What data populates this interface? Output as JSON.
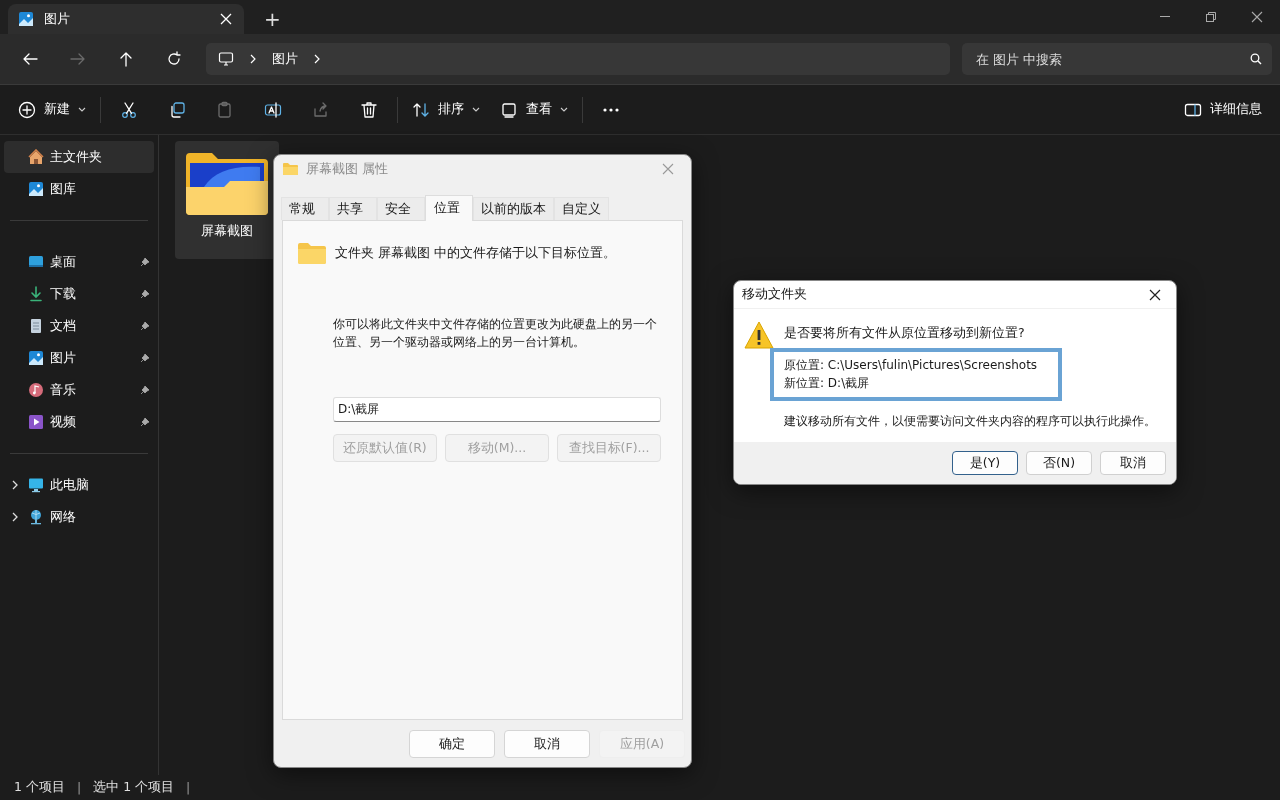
{
  "tabs": [
    {
      "title": "图片",
      "selected": true
    }
  ],
  "new_tab": "+",
  "nav": [
    {
      "kind": "back",
      "disabled": false
    },
    {
      "kind": "forward",
      "disabled": true
    },
    {
      "kind": "up",
      "disabled": false
    },
    {
      "kind": "refresh",
      "disabled": false
    }
  ],
  "breadcrumb": [
    "图片"
  ],
  "search": {
    "placeholder": "在 图片 中搜索"
  },
  "commands": [
    {
      "kind": "new",
      "label": "新建",
      "dropdown": true,
      "disabled": false
    },
    {
      "kind": "cut",
      "disabled": false
    },
    {
      "kind": "copy",
      "disabled": false
    },
    {
      "kind": "paste",
      "disabled": true
    },
    {
      "kind": "rename",
      "disabled": false
    },
    {
      "kind": "share",
      "disabled": true
    },
    {
      "kind": "delete",
      "disabled": false
    },
    {
      "kind": "sort",
      "label": "排序",
      "dropdown": true,
      "disabled": false
    },
    {
      "kind": "view",
      "label": "查看",
      "dropdown": true,
      "disabled": false
    },
    {
      "kind": "more",
      "disabled": false
    }
  ],
  "details_button": "详细信息",
  "sidebar": {
    "groups": [
      [
        {
          "kind": "home",
          "label": "主文件夹",
          "selected": true,
          "pinned": false
        },
        {
          "kind": "gallery",
          "label": "图库",
          "selected": false,
          "pinned": false
        }
      ],
      [
        {
          "kind": "desktop",
          "label": "桌面",
          "selected": false,
          "pinned": true
        },
        {
          "kind": "download",
          "label": "下载",
          "selected": false,
          "pinned": true
        },
        {
          "kind": "document",
          "label": "文档",
          "selected": false,
          "pinned": true
        },
        {
          "kind": "gallery",
          "label": "图片",
          "selected": false,
          "pinned": true
        },
        {
          "kind": "music",
          "label": "音乐",
          "selected": false,
          "pinned": true
        },
        {
          "kind": "video",
          "label": "视频",
          "selected": false,
          "pinned": true
        }
      ],
      [
        {
          "kind": "pc",
          "label": "此电脑",
          "selected": false,
          "pinned": false,
          "expanded": false
        },
        {
          "kind": "network",
          "label": "网络",
          "selected": false,
          "pinned": false,
          "expanded": false
        }
      ]
    ]
  },
  "files": [
    {
      "name": "屏幕截图",
      "selected": true
    }
  ],
  "status_bar": [
    {
      "kind": "text",
      "text": "1 个项目"
    },
    {
      "kind": "separator",
      "text": "|"
    },
    {
      "kind": "text",
      "text": "选中 1 个项目"
    },
    {
      "kind": "separator",
      "text": "|"
    }
  ],
  "properties_dialog": {
    "title": "屏幕截图 属性",
    "tabs": [
      {
        "label": "常规",
        "selected": false
      },
      {
        "label": "共享",
        "selected": false
      },
      {
        "label": "安全",
        "selected": false
      },
      {
        "label": "位置",
        "selected": true
      },
      {
        "label": "以前的版本",
        "selected": false
      },
      {
        "label": "自定义",
        "selected": false
      }
    ],
    "heading": "文件夹 屏幕截图 中的文件存储于以下目标位置。",
    "description": "你可以将此文件夹中文件存储的位置更改为此硬盘上的另一个位置、另一个驱动器或网络上的另一台计算机。",
    "path_value": "D:\\截屏",
    "actions": [
      {
        "label": "还原默认值(R)",
        "disabled": true
      },
      {
        "label": "移动(M)...",
        "disabled": true
      },
      {
        "label": "查找目标(F)...",
        "disabled": true
      }
    ],
    "buttons": [
      {
        "label": "确定",
        "disabled": false
      },
      {
        "label": "取消",
        "disabled": false
      },
      {
        "label": "应用(A)",
        "disabled": true
      }
    ]
  },
  "move_dialog": {
    "title": "移动文件夹",
    "question": "是否要将所有文件从原位置移动到新位置?",
    "details": [
      "原位置: C:\\Users\\fulin\\Pictures\\Screenshots",
      "新位置: D:\\截屏"
    ],
    "note": "建议移动所有文件，以便需要访问文件夹内容的程序可以执行此操作。",
    "buttons": [
      {
        "label": "是(Y)",
        "default": true
      },
      {
        "label": "否(N)",
        "default": false
      },
      {
        "label": "取消",
        "default": false
      }
    ]
  }
}
